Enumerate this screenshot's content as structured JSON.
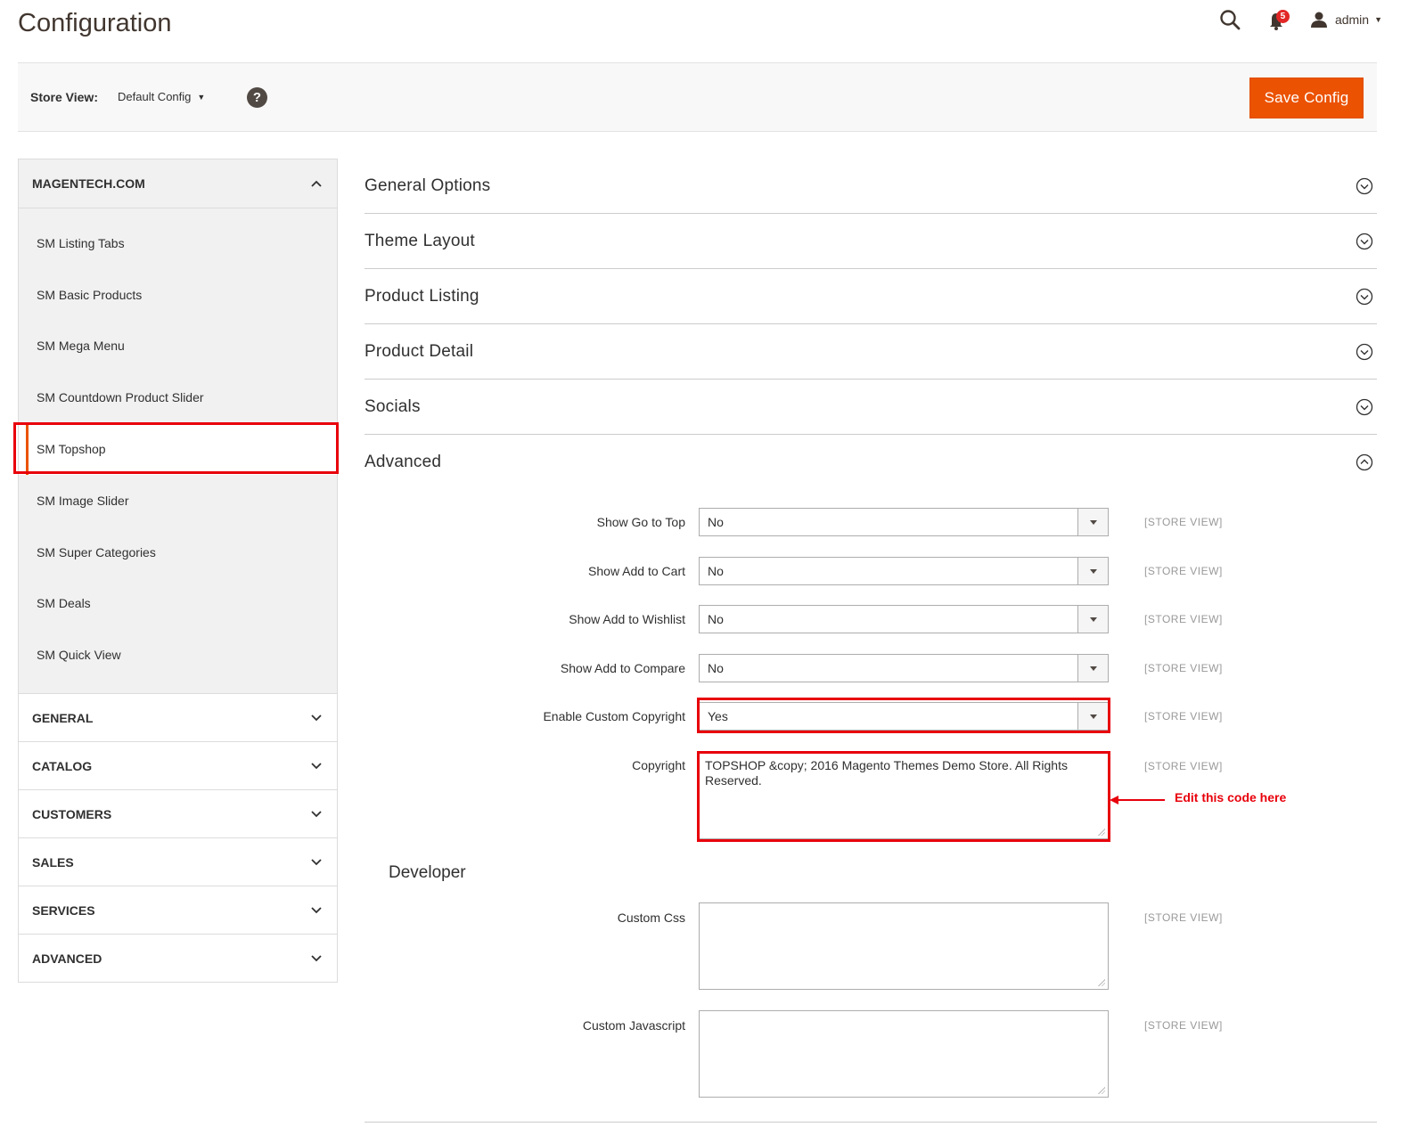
{
  "header": {
    "title": "Configuration",
    "notification_count": "5",
    "user_name": "admin"
  },
  "store_bar": {
    "label": "Store View:",
    "selected": "Default Config",
    "help": "?",
    "save_label": "Save Config"
  },
  "sidebar": {
    "open_group": {
      "title": "MAGENTECH.COM",
      "items": [
        {
          "label": "SM Listing Tabs"
        },
        {
          "label": "SM Basic Products"
        },
        {
          "label": "SM Mega Menu"
        },
        {
          "label": "SM Countdown Product Slider"
        },
        {
          "label": "SM Topshop"
        },
        {
          "label": "SM Image Slider"
        },
        {
          "label": "SM Super Categories"
        },
        {
          "label": "SM Deals"
        },
        {
          "label": "SM Quick View"
        }
      ],
      "active_item": "SM Topshop"
    },
    "sections": [
      {
        "label": "GENERAL"
      },
      {
        "label": "CATALOG"
      },
      {
        "label": "CUSTOMERS"
      },
      {
        "label": "SALES"
      },
      {
        "label": "SERVICES"
      },
      {
        "label": "ADVANCED"
      }
    ]
  },
  "main": {
    "sections": [
      {
        "label": "General Options",
        "expanded": false
      },
      {
        "label": "Theme Layout",
        "expanded": false
      },
      {
        "label": "Product Listing",
        "expanded": false
      },
      {
        "label": "Product Detail",
        "expanded": false
      },
      {
        "label": "Socials",
        "expanded": false
      },
      {
        "label": "Advanced",
        "expanded": true
      }
    ],
    "advanced_fields": [
      {
        "label": "Show Go to Top",
        "value": "No",
        "scope": "[STORE VIEW]"
      },
      {
        "label": "Show Add to Cart",
        "value": "No",
        "scope": "[STORE VIEW]"
      },
      {
        "label": "Show Add to Wishlist",
        "value": "No",
        "scope": "[STORE VIEW]"
      },
      {
        "label": "Show Add to Compare",
        "value": "No",
        "scope": "[STORE VIEW]"
      },
      {
        "label": "Enable Custom Copyright",
        "value": "Yes",
        "scope": "[STORE VIEW]"
      }
    ],
    "copyright": {
      "label": "Copyright",
      "value": "TOPSHOP  &copy;  2016 Magento Themes Demo Store. All Rights Reserved.",
      "scope": "[STORE VIEW]"
    },
    "annotation": "Edit this code here",
    "developer": {
      "title": "Developer",
      "custom_css": {
        "label": "Custom Css",
        "value": "",
        "scope": "[STORE VIEW]"
      },
      "custom_js": {
        "label": "Custom Javascript",
        "value": "",
        "scope": "[STORE VIEW]"
      }
    }
  },
  "colors": {
    "accent": "#eb5202",
    "highlight": "#e8000b",
    "badge": "#e22626"
  }
}
